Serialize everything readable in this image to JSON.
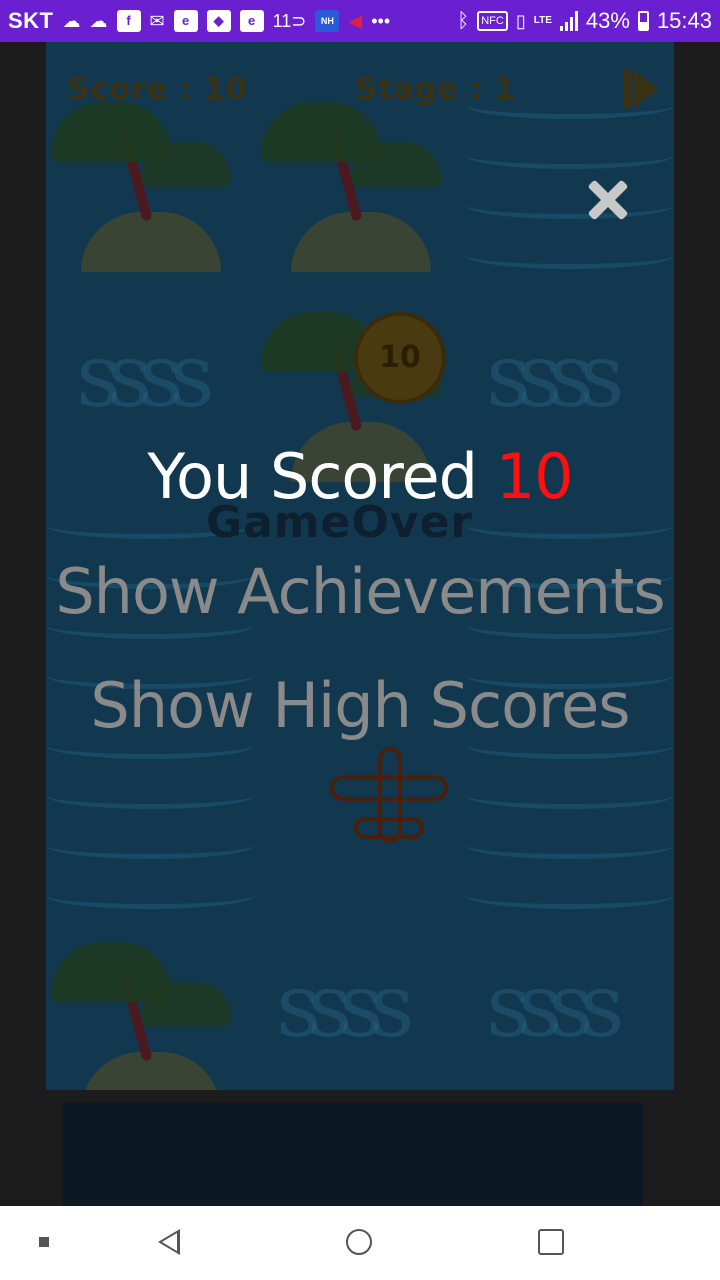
{
  "status_bar": {
    "carrier": "SKT",
    "battery": "43%",
    "time": "15:43",
    "network_label": "LTE",
    "icons_left": [
      "cloud-icon",
      "cloud-icon",
      "facebook-icon",
      "mail-icon",
      "app-icon",
      "dominos-icon",
      "app-icon",
      "11st-icon",
      "nh-bank-icon",
      "megaphone-icon",
      "more-dots-icon"
    ],
    "icons_right": [
      "bluetooth-icon",
      "nfc-icon",
      "vibrate-icon",
      "lte-icon",
      "signal-icon",
      "battery-icon"
    ]
  },
  "game": {
    "hud": {
      "score_label": "Score : 10",
      "stage_label": "Stage : 1"
    },
    "coin_value": "10",
    "gameover_text": "GameOver"
  },
  "dialog": {
    "score_prefix": "You Scored",
    "score_value": "10",
    "achievements_label": "Show Achievements",
    "highscores_label": "Show High Scores"
  },
  "colors": {
    "status_bar_bg": "#6a1fd0",
    "score_value": "#ff1010",
    "menu_text": "#8a8a8a",
    "game_bg": "#11384f"
  }
}
